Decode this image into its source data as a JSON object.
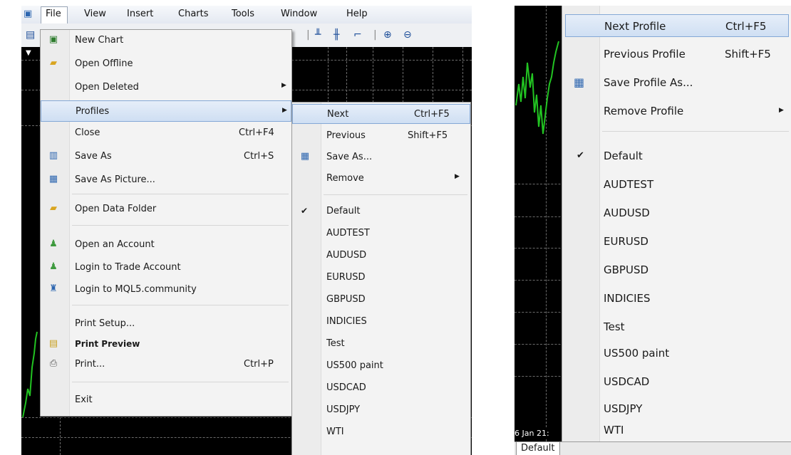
{
  "menubar": {
    "items": [
      "File",
      "View",
      "Insert",
      "Charts",
      "Tools",
      "Window",
      "Help"
    ]
  },
  "file_menu": {
    "items": [
      {
        "label": "New Chart",
        "icon": "new-chart-icon"
      },
      {
        "label": "Open Offline",
        "icon": "folder-icon"
      },
      {
        "label": "Open Deleted",
        "submenu": true
      },
      {
        "label": "Profiles",
        "submenu": true,
        "highlighted": true
      },
      {
        "label": "Close",
        "shortcut": "Ctrl+F4"
      },
      {
        "label": "Save As",
        "shortcut": "Ctrl+S",
        "icon": "save-icon"
      },
      {
        "label": "Save As Picture...",
        "icon": "picture-icon"
      },
      {
        "label": "Open Data Folder",
        "icon": "folder-icon"
      },
      {
        "label": "Open an Account",
        "icon": "user-icon"
      },
      {
        "label": "Login to Trade Account",
        "icon": "user-icon"
      },
      {
        "label": "Login to MQL5.community",
        "icon": "community-icon"
      },
      {
        "label": "Print Setup..."
      },
      {
        "label": "Print Preview",
        "icon": "print-preview-icon"
      },
      {
        "label": "Print...",
        "shortcut": "Ctrl+P",
        "icon": "printer-icon"
      },
      {
        "label": "Exit"
      }
    ]
  },
  "profiles_submenu": {
    "next": {
      "label": "Next",
      "shortcut": "Ctrl+F5"
    },
    "previous": {
      "label": "Previous",
      "shortcut": "Shift+F5"
    },
    "save_as": {
      "label": "Save As..."
    },
    "remove": {
      "label": "Remove"
    },
    "profiles": [
      "Default",
      "AUDTEST",
      "AUDUSD",
      "EURUSD",
      "GBPUSD",
      "INDICIES",
      "Test",
      "US500 paint",
      "USDCAD",
      "USDJPY",
      "WTI"
    ],
    "checked": "Default"
  },
  "right_menu": {
    "next": {
      "label": "Next Profile",
      "shortcut": "Ctrl+F5"
    },
    "previous": {
      "label": "Previous Profile",
      "shortcut": "Shift+F5"
    },
    "save_as": {
      "label": "Save Profile As..."
    },
    "remove": {
      "label": "Remove Profile"
    },
    "profiles": [
      "Default",
      "AUDTEST",
      "AUDUSD",
      "EURUSD",
      "GBPUSD",
      "INDICIES",
      "Test",
      "US500 paint",
      "USDCAD",
      "USDJPY",
      "WTI"
    ],
    "checked": "Default"
  },
  "right_chart": {
    "date_label": "6 Jan 21:"
  },
  "status": {
    "profile_tab": "Default"
  },
  "colors": {
    "highlight": "#cfdff3",
    "chart_bg": "#000000",
    "candle": "#22c322"
  }
}
